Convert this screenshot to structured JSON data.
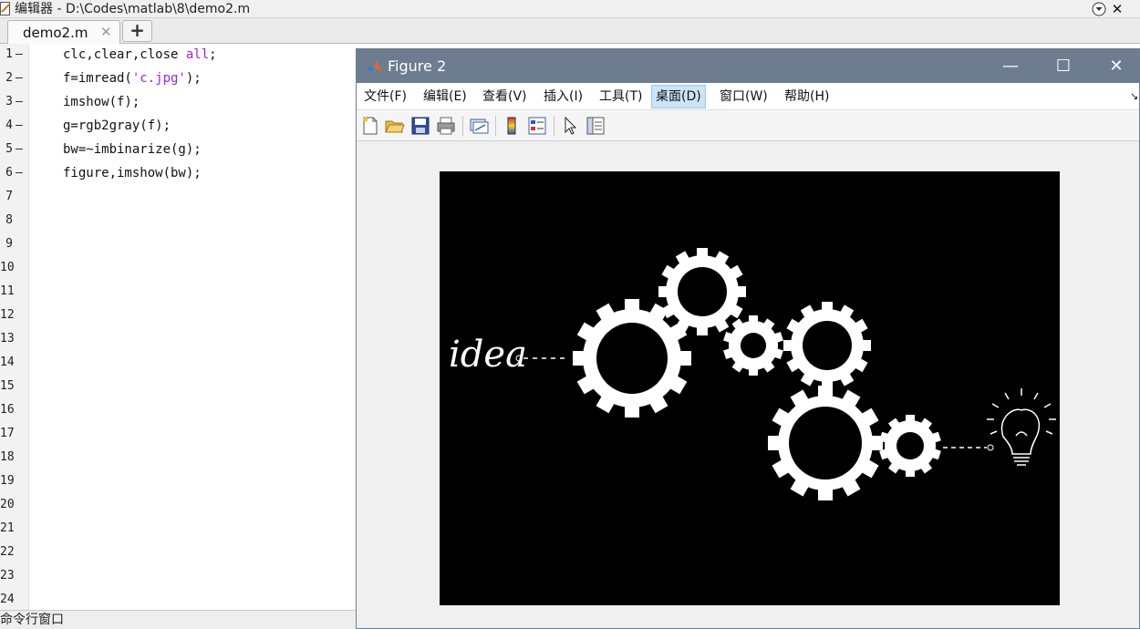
{
  "editor": {
    "title": "编辑器 - D:\\Codes\\matlab\\8\\demo2.m",
    "tab_label": "demo2.m",
    "tab_close": "✕",
    "tab_add": "+",
    "close_symbol": "✕",
    "dash": "—",
    "line_numbers": [
      "1",
      "2",
      "3",
      "4",
      "5",
      "6",
      "7",
      "8",
      "9",
      "10",
      "11",
      "12",
      "13",
      "14",
      "15",
      "16",
      "17",
      "18",
      "19",
      "20",
      "21",
      "22",
      "23",
      "24"
    ],
    "code_lines": [
      {
        "pre": "clc,clear,close ",
        "str": "all",
        "post": ";"
      },
      {
        "pre": "f=imread(",
        "str": "'c.jpg'",
        "post": ");"
      },
      {
        "pre": "imshow(f);",
        "str": "",
        "post": ""
      },
      {
        "pre": "g=rgb2gray(f);",
        "str": "",
        "post": ""
      },
      {
        "pre": "bw=~imbinarize(g);",
        "str": "",
        "post": ""
      },
      {
        "pre": "figure,imshow(bw);",
        "str": "",
        "post": ""
      }
    ]
  },
  "command_window": {
    "label": "命令行窗口"
  },
  "figure": {
    "title": "Figure 2",
    "minimize": "—",
    "maximize": "☐",
    "close": "✕",
    "menus": [
      {
        "label": "文件(F)",
        "active": false
      },
      {
        "label": "编辑(E)",
        "active": false
      },
      {
        "label": "查看(V)",
        "active": false
      },
      {
        "label": "插入(I)",
        "active": false
      },
      {
        "label": "工具(T)",
        "active": false
      },
      {
        "label": "桌面(D)",
        "active": true
      },
      {
        "label": "窗口(W)",
        "active": false
      },
      {
        "label": "帮助(H)",
        "active": false
      }
    ],
    "menu_overflow": "↘",
    "toolbar_icons": [
      "new-figure-icon",
      "open-file-icon",
      "save-icon",
      "print-icon",
      "link-plot-icon",
      "colorbar-icon",
      "legend-icon",
      "select-arrow-icon",
      "property-inspector-icon"
    ],
    "image": {
      "word": "idea",
      "description_tokens": [
        "gears",
        "lightbulb"
      ]
    }
  }
}
